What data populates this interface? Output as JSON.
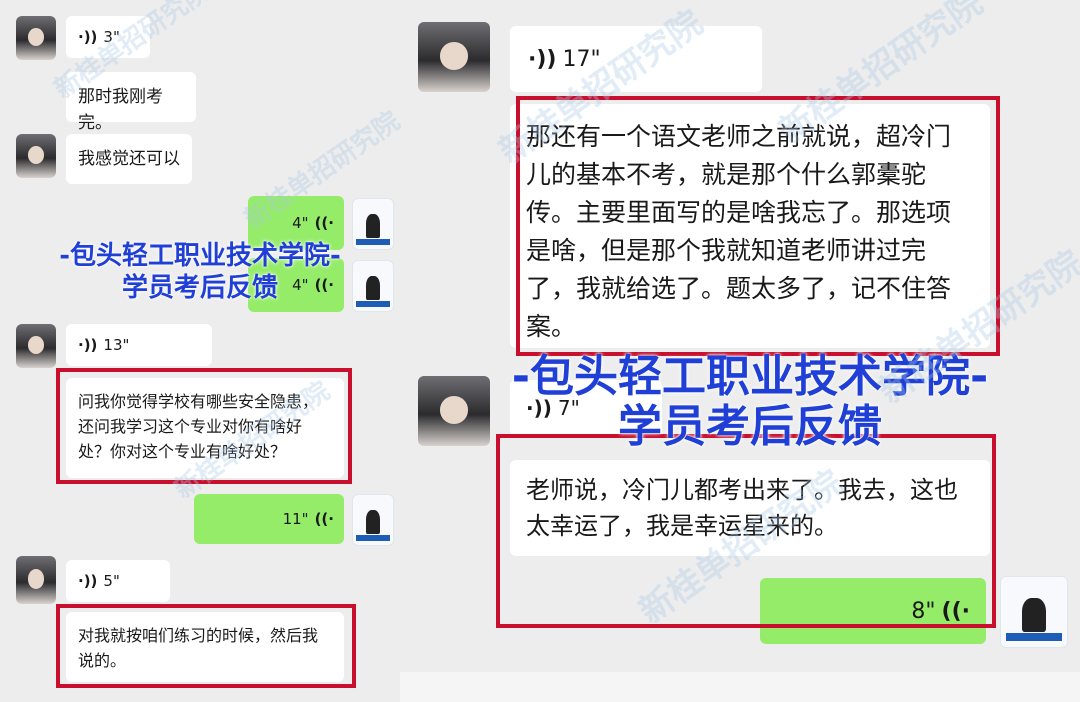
{
  "left_chat": {
    "messages": [
      {
        "type": "voice",
        "side": "left",
        "duration": "3\""
      },
      {
        "type": "text",
        "side": "left",
        "text": "那时我刚考完。"
      },
      {
        "type": "text",
        "side": "left",
        "text": "我感觉还可以"
      },
      {
        "type": "voice",
        "side": "right",
        "duration": "4\""
      },
      {
        "type": "voice",
        "side": "right",
        "duration": "4\""
      },
      {
        "type": "voice",
        "side": "left",
        "duration": "13\""
      },
      {
        "type": "text",
        "side": "left",
        "text": "问我你觉得学校有哪些安全隐患，还问我学习这个专业对你有啥好处？你对这个专业有啥好处？"
      },
      {
        "type": "voice",
        "side": "right",
        "duration": "11\""
      },
      {
        "type": "voice",
        "side": "left",
        "duration": "5\""
      },
      {
        "type": "text",
        "side": "left",
        "text": "对我就按咱们练习的时候，然后我说的。"
      }
    ],
    "overlay_line1": "-包头轻工职业技术学院-",
    "overlay_line2": "学员考后反馈"
  },
  "right_chat": {
    "messages": [
      {
        "type": "voice",
        "side": "left",
        "duration": "17\""
      },
      {
        "type": "text",
        "side": "left",
        "text": "那还有一个语文老师之前就说，超冷门儿的基本不考，就是那个什么郭橐驼传。主要里面写的是啥我忘了。那选项是啥，但是那个我就知道老师讲过完了，我就给选了。题太多了，记不住答案。"
      },
      {
        "type": "voice",
        "side": "left",
        "duration": "7\""
      },
      {
        "type": "text",
        "side": "left",
        "text": "老师说，冷门儿都考出来了。我去，这也太幸运了，我是幸运星来的。"
      },
      {
        "type": "voice",
        "side": "right",
        "duration": "8\""
      }
    ],
    "overlay_line1": "-包头轻工职业技术学院-",
    "overlay_line2": "学员考后反馈"
  },
  "watermark_text": "新桂单招研究院",
  "voice_icon": "sound-wave-icon",
  "colors": {
    "green_bubble": "#95ec69",
    "highlight_box": "#c8102e",
    "overlay_text": "#1f3fd6"
  }
}
